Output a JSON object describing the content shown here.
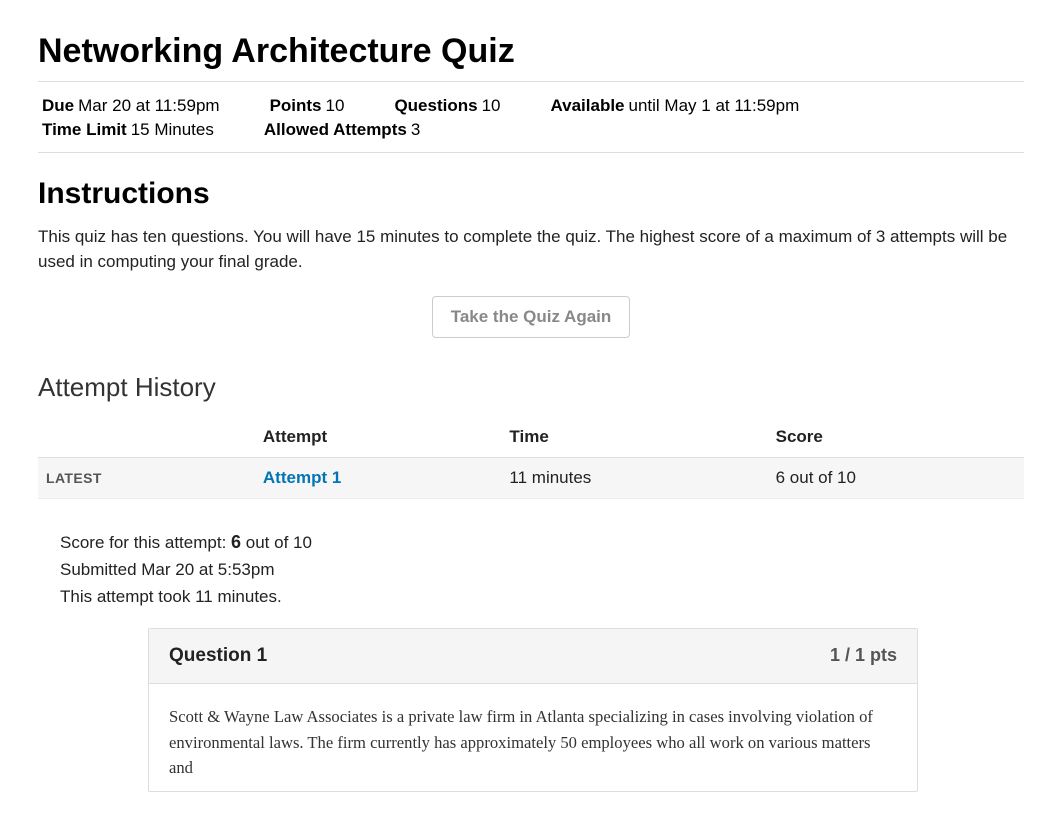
{
  "title": "Networking Architecture Quiz",
  "meta": {
    "due_label": "Due",
    "due_value": "Mar 20 at 11:59pm",
    "points_label": "Points",
    "points_value": "10",
    "questions_label": "Questions",
    "questions_value": "10",
    "available_label": "Available",
    "available_value": "until May 1 at 11:59pm",
    "timelimit_label": "Time Limit",
    "timelimit_value": "15 Minutes",
    "attempts_label": "Allowed Attempts",
    "attempts_value": "3"
  },
  "instructions_heading": "Instructions",
  "instructions_text": "This quiz has ten questions. You will have 15 minutes to complete the quiz. The highest score of a maximum of 3 attempts will be used in computing your final grade.",
  "take_again": "Take the Quiz Again",
  "history_heading": "Attempt History",
  "history": {
    "columns": {
      "attempt": "Attempt",
      "time": "Time",
      "score": "Score"
    },
    "rows": [
      {
        "tag": "LATEST",
        "attempt": "Attempt 1",
        "time": "11 minutes",
        "score": "6 out of 10"
      }
    ]
  },
  "attempt_detail": {
    "score_prefix": "Score for this attempt: ",
    "score_value": "6",
    "score_suffix": " out of 10",
    "submitted": "Submitted Mar 20 at 5:53pm",
    "duration": "This attempt took 11 minutes."
  },
  "question": {
    "title": "Question 1",
    "points": "1 / 1 pts",
    "body": "Scott & Wayne Law Associates is a private law firm in Atlanta specializing in cases involving violation of environmental laws. The firm currently has approximately 50 employees who all work on various matters and"
  }
}
